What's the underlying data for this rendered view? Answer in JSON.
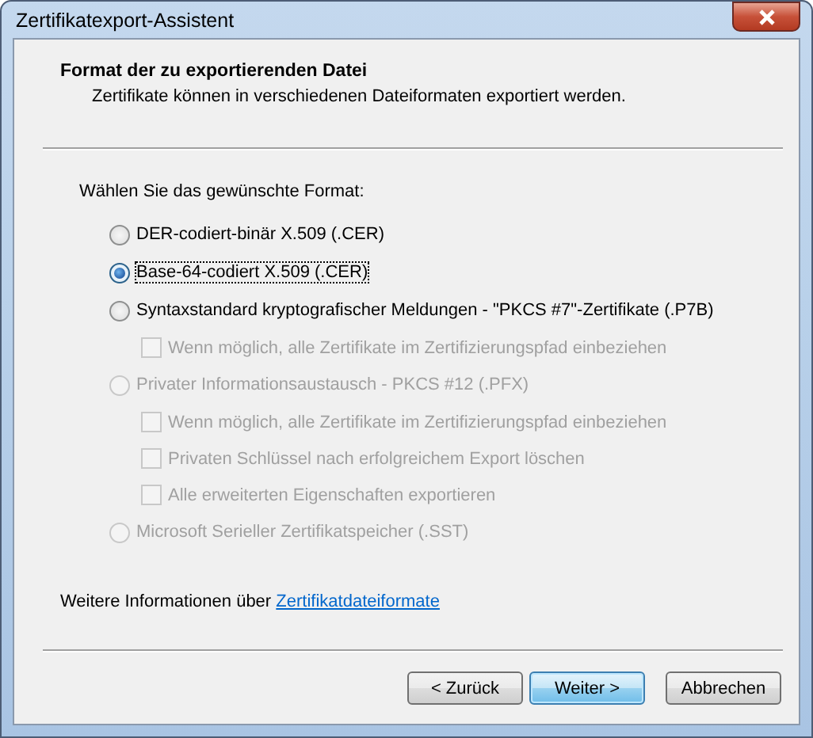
{
  "window": {
    "title": "Zertifikatexport-Assistent"
  },
  "header": {
    "title": "Format der zu exportierenden Datei",
    "subtitle": "Zertifikate können in verschiedenen Dateiformaten exportiert werden."
  },
  "prompt": "Wählen Sie das gewünschte Format:",
  "formats": [
    {
      "label": "DER-codiert-binär X.509 (.CER)",
      "selected": false,
      "disabled": false
    },
    {
      "label": "Base-64-codiert X.509 (.CER)",
      "selected": true,
      "disabled": false
    },
    {
      "label": "Syntaxstandard kryptografischer Meldungen - \"PKCS #7\"-Zertifikate (.P7B)",
      "selected": false,
      "disabled": false,
      "options": [
        {
          "label": "Wenn möglich, alle Zertifikate im Zertifizierungspfad einbeziehen",
          "checked": false,
          "disabled": true
        }
      ]
    },
    {
      "label": "Privater Informationsaustausch - PKCS #12 (.PFX)",
      "selected": false,
      "disabled": true,
      "options": [
        {
          "label": "Wenn möglich, alle Zertifikate im Zertifizierungspfad einbeziehen",
          "checked": false,
          "disabled": true
        },
        {
          "label": "Privaten Schlüssel nach erfolgreichem Export löschen",
          "checked": false,
          "disabled": true
        },
        {
          "label": "Alle erweiterten Eigenschaften exportieren",
          "checked": false,
          "disabled": true
        }
      ]
    },
    {
      "label": "Microsoft Serieller Zertifikatspeicher (.SST)",
      "selected": false,
      "disabled": true
    }
  ],
  "more_info": {
    "text": "Weitere Informationen über",
    "link": "Zertifikatdateiformate"
  },
  "buttons": [
    {
      "label": "< Zurück",
      "default": false
    },
    {
      "label": "Weiter >",
      "default": true
    },
    {
      "label": "Abbrechen",
      "default": false
    }
  ]
}
